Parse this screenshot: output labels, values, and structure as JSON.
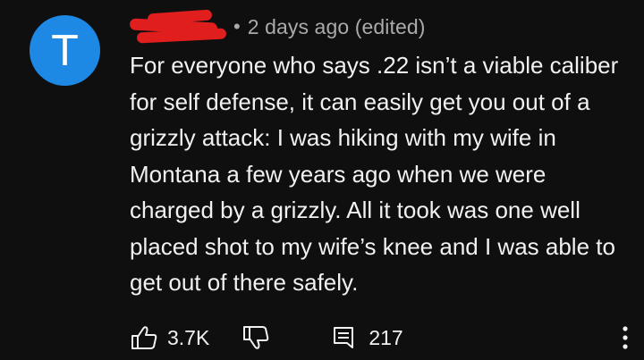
{
  "comment": {
    "avatar_letter": "T",
    "avatar_color": "#1e88e5",
    "author_redacted": true,
    "separator": "•",
    "timestamp": "2 days ago (edited)",
    "text": "For everyone who says .22 isn’t a viable caliber for self defense, it can easily get you out of a grizzly attack: I was hiking with my wife in Montana a few years ago when we were charged by a grizzly. All it took was one well placed shot to my wife’s knee and I was able to get out of there safely.",
    "likes": "3.7K",
    "replies": "217"
  },
  "icons": {
    "like": "thumbs-up-icon",
    "dislike": "thumbs-down-icon",
    "reply": "reply-icon",
    "more": "more-vert-icon"
  },
  "colors": {
    "background": "#0f0f0f",
    "text": "#f1f1f1",
    "secondary": "#aaaaaa",
    "redaction": "#e01e1e"
  }
}
